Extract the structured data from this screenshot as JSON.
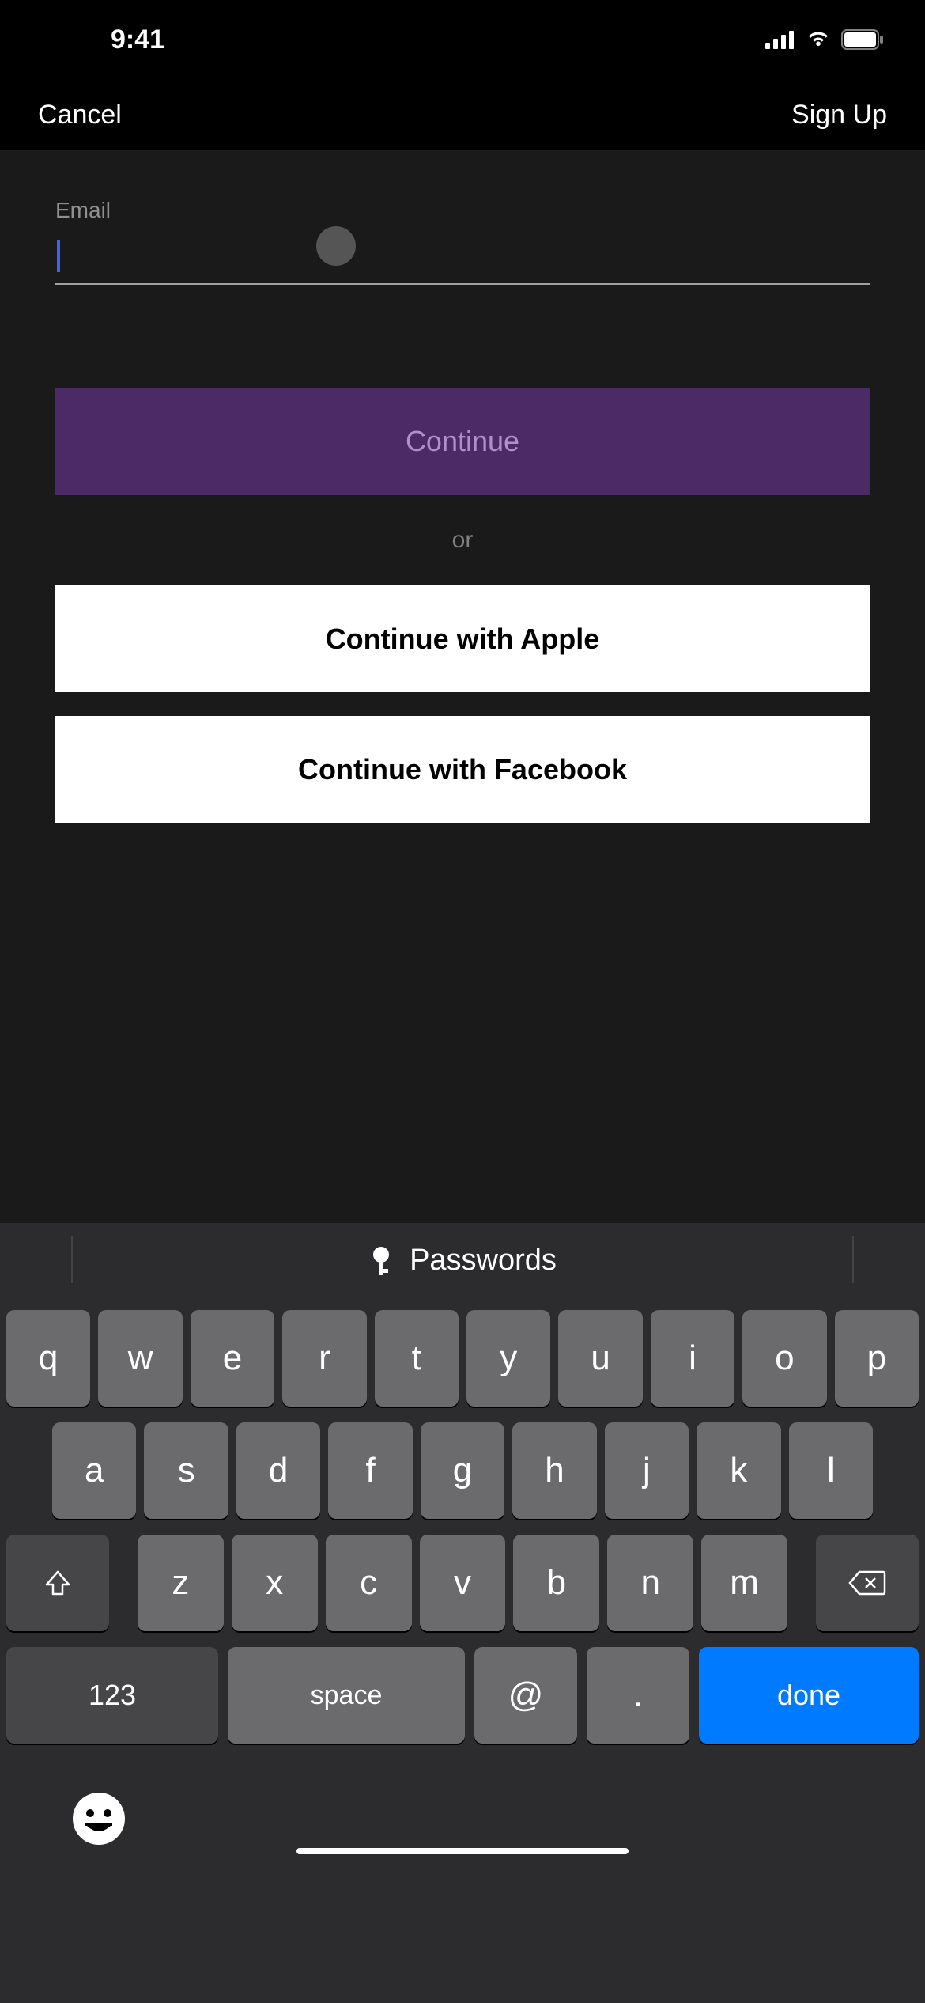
{
  "status": {
    "time": "9:41"
  },
  "nav": {
    "cancel": "Cancel",
    "signup": "Sign Up"
  },
  "form": {
    "email_label": "Email",
    "email_value": "",
    "continue": "Continue",
    "or": "or",
    "apple": "Continue with Apple",
    "facebook": "Continue with Facebook"
  },
  "keyboard": {
    "suggestion": "Passwords",
    "row1": [
      "q",
      "w",
      "e",
      "r",
      "t",
      "y",
      "u",
      "i",
      "o",
      "p"
    ],
    "row2": [
      "a",
      "s",
      "d",
      "f",
      "g",
      "h",
      "j",
      "k",
      "l"
    ],
    "row3": [
      "z",
      "x",
      "c",
      "v",
      "b",
      "n",
      "m"
    ],
    "numKey": "123",
    "space": "space",
    "at": "@",
    "dot": ".",
    "done": "done"
  }
}
